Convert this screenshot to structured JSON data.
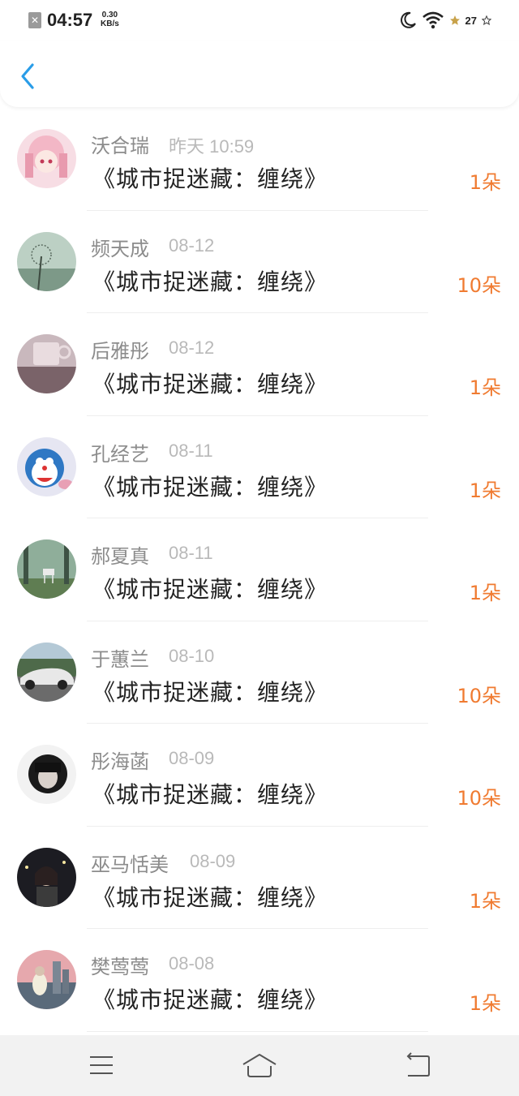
{
  "status_bar": {
    "time": "04:57",
    "net_speed_value": "0.30",
    "net_speed_unit": "KB/s",
    "battery": "27",
    "icons": [
      "close-square-icon",
      "moon-icon",
      "wifi-icon",
      "star-icon",
      "battery-icon"
    ]
  },
  "header": {
    "back_icon": "chevron-left-icon",
    "accent_color": "#2a9de8"
  },
  "colors": {
    "count": "#f07b31",
    "name": "#8c8c8c",
    "time": "#b9b9b9",
    "title": "#222222"
  },
  "items": [
    {
      "name": "沃合瑞",
      "time": "昨天 10:59",
      "title": "《城市捉迷藏：缠绕》",
      "count": "1朵"
    },
    {
      "name": "频天成",
      "time": "08-12",
      "title": "《城市捉迷藏：缠绕》",
      "count": "10朵"
    },
    {
      "name": "后雅彤",
      "time": "08-12",
      "title": "《城市捉迷藏：缠绕》",
      "count": "1朵"
    },
    {
      "name": "孔经艺",
      "time": "08-11",
      "title": "《城市捉迷藏：缠绕》",
      "count": "1朵"
    },
    {
      "name": "郝夏真",
      "time": "08-11",
      "title": "《城市捉迷藏：缠绕》",
      "count": "1朵"
    },
    {
      "name": "于蕙兰",
      "time": "08-10",
      "title": "《城市捉迷藏：缠绕》",
      "count": "10朵"
    },
    {
      "name": "彤海菡",
      "time": "08-09",
      "title": "《城市捉迷藏：缠绕》",
      "count": "10朵"
    },
    {
      "name": "巫马恬美",
      "time": "08-09",
      "title": "《城市捉迷藏：缠绕》",
      "count": "1朵"
    },
    {
      "name": "樊莺莺",
      "time": "08-08",
      "title": "《城市捉迷藏：缠绕》",
      "count": "1朵"
    }
  ],
  "nav": {
    "icons": [
      "menu-icon",
      "home-icon",
      "back-icon"
    ]
  }
}
